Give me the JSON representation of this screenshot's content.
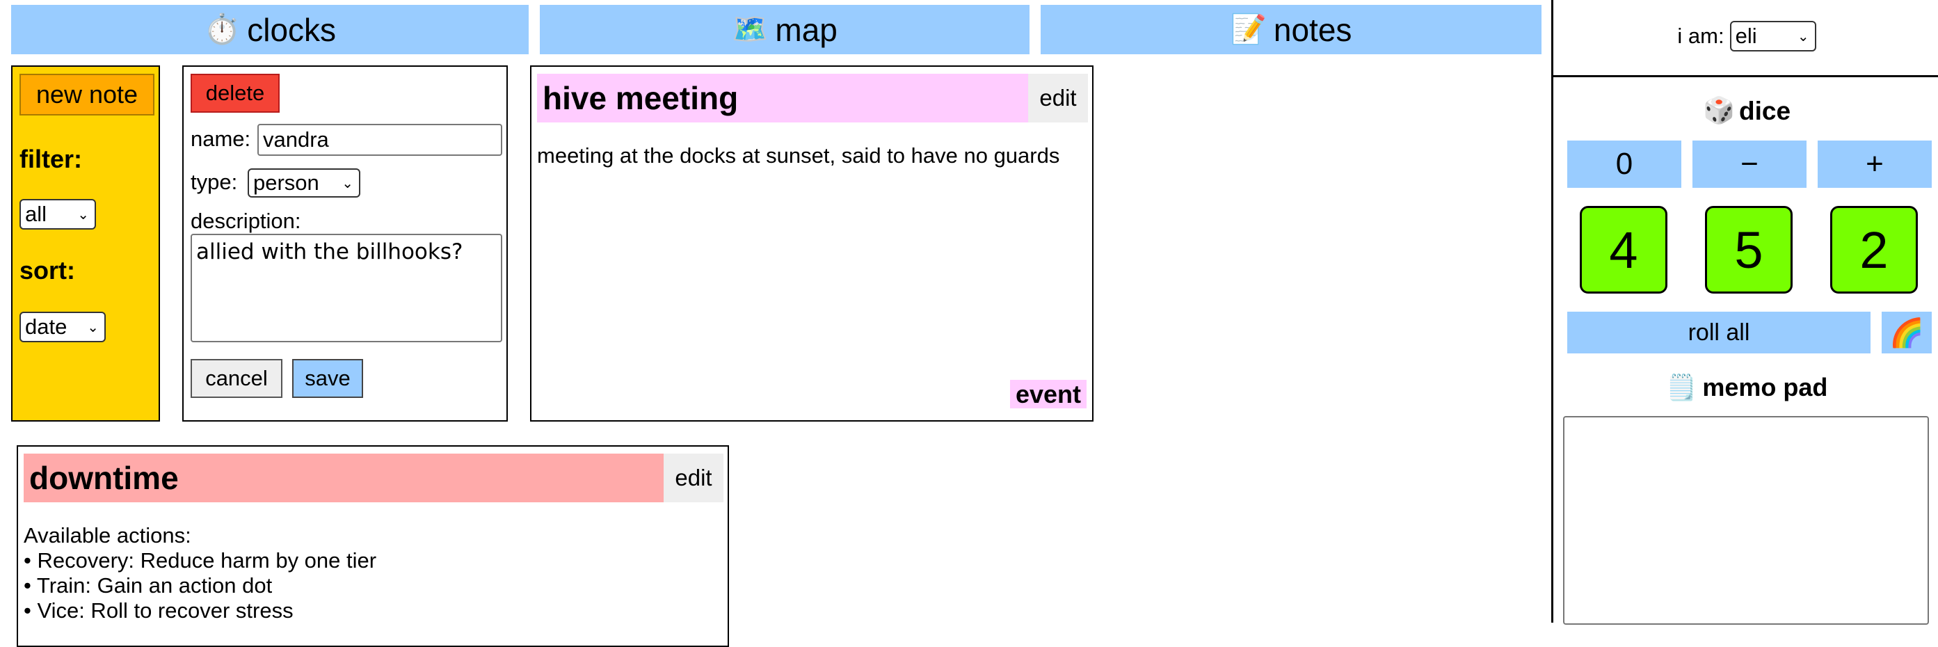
{
  "tabs": [
    {
      "icon": "⏱️",
      "label": "clocks"
    },
    {
      "icon": "🗺️",
      "label": "map"
    },
    {
      "icon": "📝",
      "label": "notes"
    }
  ],
  "filter_panel": {
    "new_note_label": "new note",
    "filter_label": "filter:",
    "filter_value": "all",
    "sort_label": "sort:",
    "sort_value": "date"
  },
  "editor": {
    "delete_label": "delete",
    "name_label": "name:",
    "name_value": "vandra",
    "type_label": "type:",
    "type_value": "person",
    "description_label": "description:",
    "description_value": "allied with the billhooks?",
    "cancel_label": "cancel",
    "save_label": "save"
  },
  "notes": [
    {
      "title": "hive meeting",
      "edit_label": "edit",
      "body": "meeting at the docks at sunset, said to have no guards",
      "tag": "event",
      "title_color": "#ffccff"
    },
    {
      "title": "downtime",
      "edit_label": "edit",
      "body_heading": "Available actions:",
      "body_items": [
        "• Recovery: Reduce harm by one tier",
        "• Train: Gain an action dot",
        "• Vice: Roll to recover stress"
      ],
      "title_color": "#ffaaaa"
    }
  ],
  "user": {
    "label": "i am:",
    "value": "eli"
  },
  "dice": {
    "icon": "🎲",
    "title": "dice",
    "count_display": "0",
    "minus_label": "−",
    "plus_label": "+",
    "values": [
      "4",
      "5",
      "2"
    ],
    "roll_all_label": "roll all",
    "rainbow_icon": "🌈",
    "die_color": "#77ff00"
  },
  "memo": {
    "icon": "🗒️",
    "title": "memo pad",
    "content": ""
  },
  "colors": {
    "tab_blue": "#99ccff",
    "filter_yellow": "#ffd400",
    "new_note_orange": "#ffaa00",
    "delete_red": "#f44336"
  }
}
